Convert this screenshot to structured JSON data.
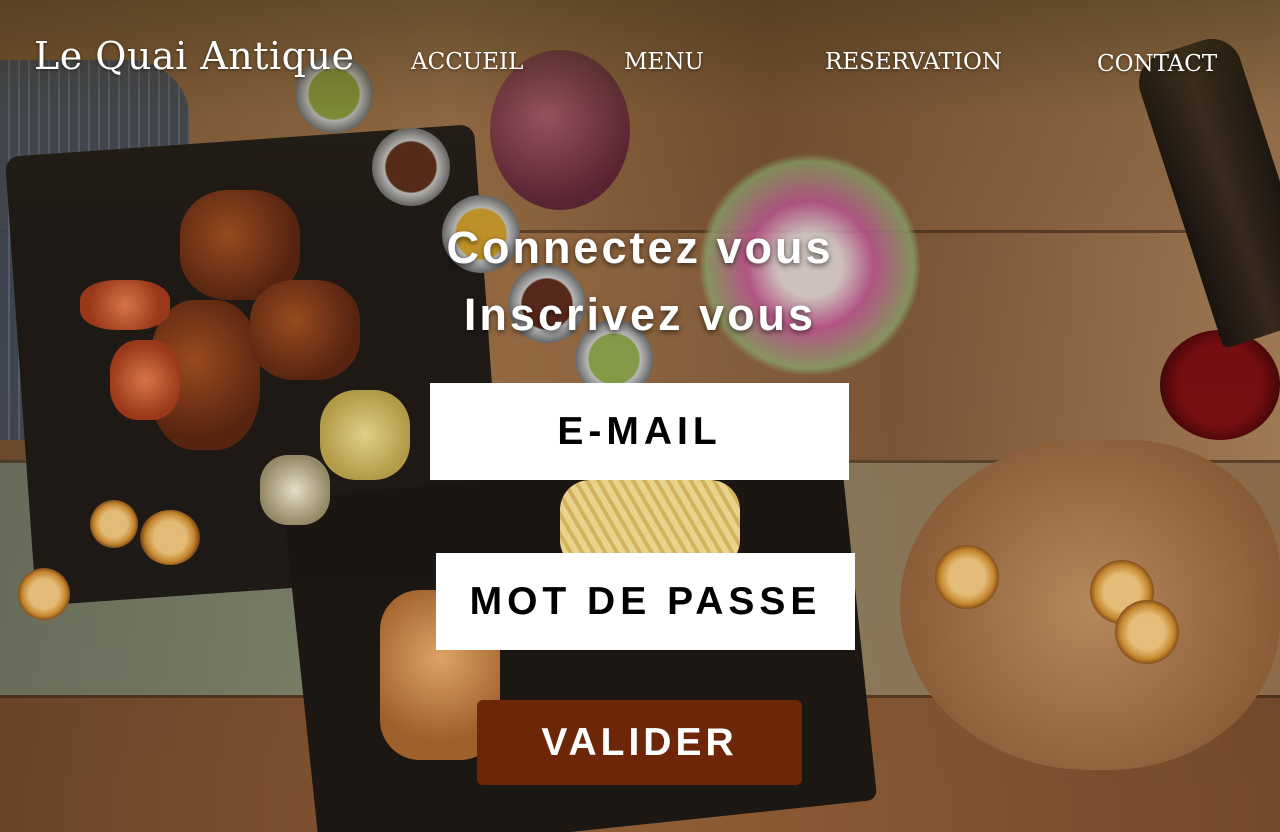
{
  "header": {
    "brand": "Le Quai Antique",
    "nav": [
      "ACCUEIL",
      "MENU",
      "RESERVATION",
      "CONTACT"
    ]
  },
  "main": {
    "heading_login": "Connectez vous",
    "heading_signup": "Inscrivez vous",
    "email_placeholder": "E-MAIL",
    "password_placeholder": "MOT DE PASSE",
    "submit_label": "VALIDER"
  },
  "colors": {
    "submit_button": "#6d2607",
    "field_background": "#ffffff",
    "text": "#ffffff"
  },
  "background": {
    "description_icon": "food-table-photo"
  }
}
